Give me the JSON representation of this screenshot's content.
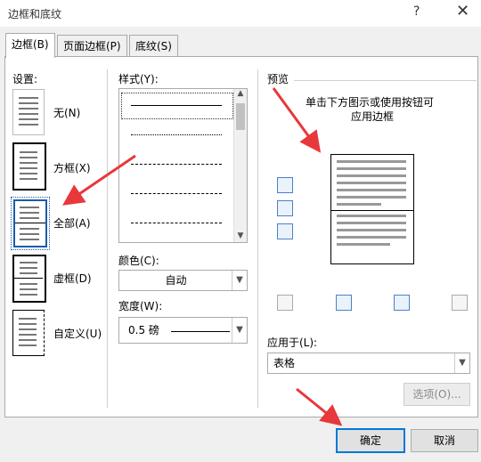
{
  "window": {
    "title": "边框和底纹",
    "help_glyph": "?",
    "close_glyph": "✕"
  },
  "tabs": [
    {
      "label": "边框(B)"
    },
    {
      "label": "页面边框(P)"
    },
    {
      "label": "底纹(S)"
    }
  ],
  "settings": {
    "heading": "设置:",
    "items": [
      {
        "label": "无(N)"
      },
      {
        "label": "方框(X)"
      },
      {
        "label": "全部(A)",
        "selected": true
      },
      {
        "label": "虚框(D)"
      },
      {
        "label": "自定义(U)"
      }
    ]
  },
  "style": {
    "heading": "样式(Y):"
  },
  "color": {
    "heading": "颜色(C):",
    "value": "自动"
  },
  "width": {
    "heading": "宽度(W):",
    "value": "0.5 磅"
  },
  "preview": {
    "heading": "预览",
    "instruction_line1": "单击下方图示或使用按钮可",
    "instruction_line2": "应用边框"
  },
  "apply_to": {
    "heading": "应用于(L):",
    "value": "表格"
  },
  "buttons": {
    "options": "选项(O)...",
    "ok": "确定",
    "cancel": "取消"
  },
  "colors": {
    "accent": "#0078d7",
    "arrow": "#e8383b"
  }
}
